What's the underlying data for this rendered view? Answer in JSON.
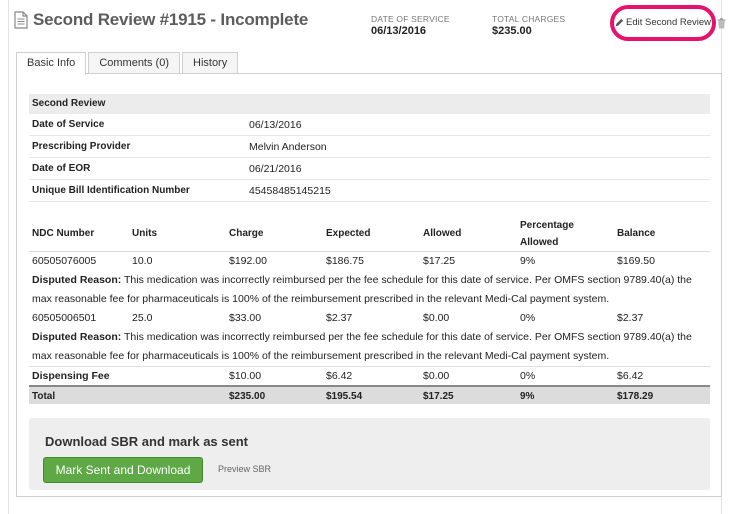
{
  "header": {
    "title": "Second Review #1915 - Incomplete",
    "date_of_service_label": "DATE OF SERVICE",
    "date_of_service": "06/13/2016",
    "total_charges_label": "TOTAL CHARGES",
    "total_charges": "$235.00",
    "edit_label": "Edit Second Review",
    "icons": {
      "document": "document-icon",
      "edit": "pencil-icon",
      "delete": "trash-icon"
    },
    "highlight_color": "#e8126e"
  },
  "tabs": [
    {
      "label": "Basic Info",
      "active": true
    },
    {
      "label": "Comments (0)",
      "active": false
    },
    {
      "label": "History",
      "active": false
    }
  ],
  "info": {
    "section_title": "Second Review",
    "rows": [
      {
        "label": "Date of Service",
        "value": "06/13/2016"
      },
      {
        "label": "Prescribing Provider",
        "value": "Melvin Anderson"
      },
      {
        "label": "Date of EOR",
        "value": "06/21/2016"
      },
      {
        "label": "Unique Bill Identification Number",
        "value": "45458485145215"
      }
    ]
  },
  "meds": {
    "columns": [
      "NDC Number",
      "Units",
      "Charge",
      "Expected",
      "Allowed",
      "Percentage Allowed",
      "Balance"
    ],
    "items": [
      {
        "cells": [
          "60505076005",
          "10.0",
          "$192.00",
          "$186.75",
          "$17.25",
          "9%",
          "$169.50"
        ],
        "reason_label": "Disputed Reason:",
        "reason_text": " This medication was incorrectly reimbursed per the fee schedule for this date of service. Per OMFS section 9789.40(a) the max reasonable fee for pharmaceuticals is 100% of the reimbursement prescribed in the relevant Medi-Cal payment system."
      },
      {
        "cells": [
          "60505006501",
          "25.0",
          "$33.00",
          "$2.37",
          "$0.00",
          "0%",
          "$2.37"
        ],
        "reason_label": "Disputed Reason:",
        "reason_text": " This medication was incorrectly reimbursed per the fee schedule for this date of service. Per OMFS section 9789.40(a) the max reasonable fee for pharmaceuticals is 100% of the reimbursement prescribed in the relevant Medi-Cal payment system."
      }
    ],
    "dispensing": [
      "Dispensing Fee",
      "",
      "$10.00",
      "$6.42",
      "$0.00",
      "0%",
      "$6.42"
    ],
    "total": [
      "Total",
      "",
      "$235.00",
      "$195.54",
      "$17.25",
      "9%",
      "$178.29"
    ]
  },
  "sbr": {
    "title": "Download SBR and mark as sent",
    "button_label": "Mark Sent and Download",
    "preview_label": "Preview SBR",
    "button_color": "#5ea845"
  }
}
